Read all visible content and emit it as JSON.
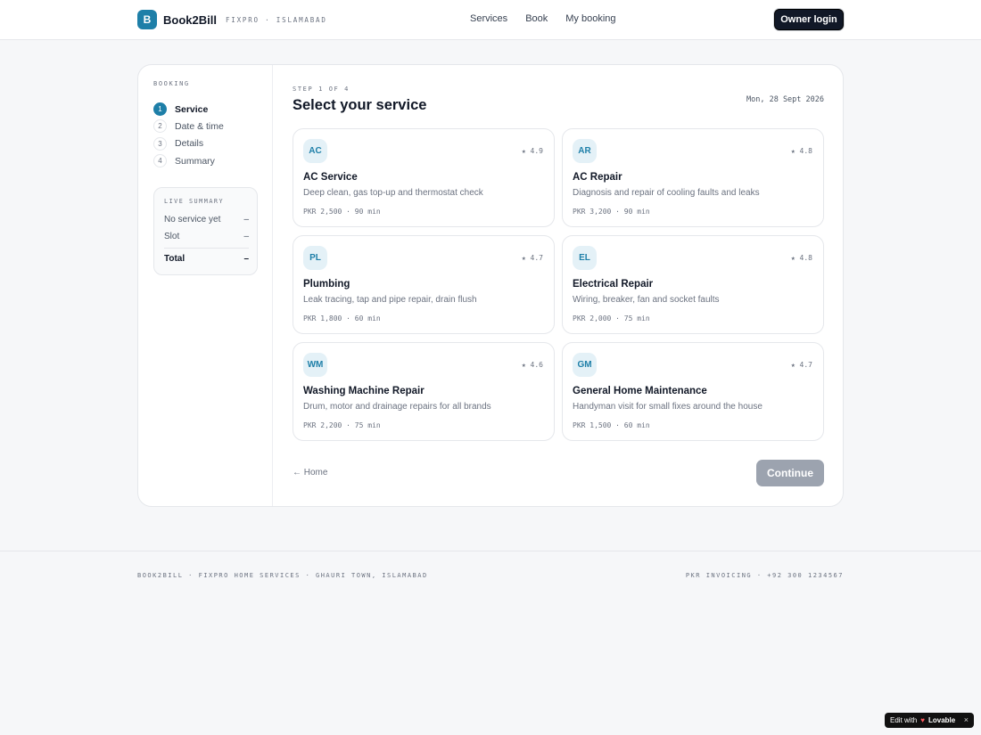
{
  "header": {
    "logo_letter": "B",
    "brand_name": "Book2Bill",
    "brand_sub": "FIXPRO · ISLAMABAD",
    "nav": [
      "Services",
      "Book",
      "My booking"
    ],
    "owner_login": "Owner login"
  },
  "sidebar": {
    "title": "BOOKING",
    "steps": [
      {
        "num": "1",
        "label": "Service"
      },
      {
        "num": "2",
        "label": "Date & time"
      },
      {
        "num": "3",
        "label": "Details"
      },
      {
        "num": "4",
        "label": "Summary"
      }
    ],
    "live_summary": {
      "title": "LIVE SUMMARY",
      "service_label": "No service yet",
      "service_value": "–",
      "slot_label": "Slot",
      "slot_value": "–",
      "total_label": "Total",
      "total_value": "–"
    }
  },
  "main": {
    "step_indicator": "STEP 1 OF 4",
    "heading": "Select your service",
    "date": "Mon, 28 Sept 2026",
    "services": [
      {
        "code": "AC",
        "name": "AC Service",
        "rating": "★ 4.9",
        "desc": "Deep clean, gas top-up and thermostat check",
        "meta": "PKR 2,500 · 90 min"
      },
      {
        "code": "AR",
        "name": "AC Repair",
        "rating": "★ 4.8",
        "desc": "Diagnosis and repair of cooling faults and leaks",
        "meta": "PKR 3,200 · 90 min"
      },
      {
        "code": "PL",
        "name": "Plumbing",
        "rating": "★ 4.7",
        "desc": "Leak tracing, tap and pipe repair, drain flush",
        "meta": "PKR 1,800 · 60 min"
      },
      {
        "code": "EL",
        "name": "Electrical Repair",
        "rating": "★ 4.8",
        "desc": "Wiring, breaker, fan and socket faults",
        "meta": "PKR 2,000 · 75 min"
      },
      {
        "code": "WM",
        "name": "Washing Machine Repair",
        "rating": "★ 4.6",
        "desc": "Drum, motor and drainage repairs for all brands",
        "meta": "PKR 2,200 · 75 min"
      },
      {
        "code": "GM",
        "name": "General Home Maintenance",
        "rating": "★ 4.7",
        "desc": "Handyman visit for small fixes around the house",
        "meta": "PKR 1,500 · 60 min"
      }
    ],
    "home_link": "← Home",
    "continue": "Continue"
  },
  "footer": {
    "left": "BOOK2BILL · FIXPRO HOME SERVICES · GHAURI TOWN, ISLAMABAD",
    "right": "PKR INVOICING · +92 300 1234567"
  },
  "badge": {
    "prefix": "Edit with",
    "brand": "Lovable",
    "close": "×"
  },
  "colors": {
    "accent": "#1e7fa8",
    "dark_button": "#111827",
    "disabled_button": "#9ca3af",
    "page_bg": "#f6f7f9"
  }
}
